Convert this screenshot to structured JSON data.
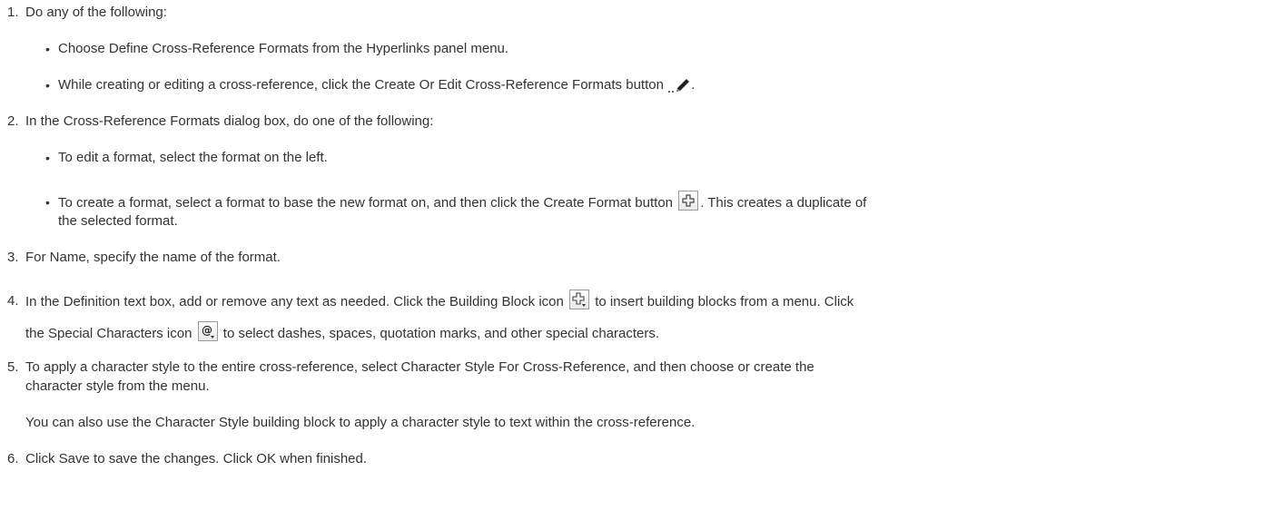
{
  "steps": [
    {
      "number": "1.",
      "text": "Do any of the following:"
    },
    {
      "number": "2.",
      "text": "In the Cross-Reference Formats dialog box, do one of the following:"
    },
    {
      "number": "3.",
      "text": "For Name, specify the name of the format."
    },
    {
      "number": "4.",
      "text_a": "In the Definition text box, add or remove any text as needed. Click the Building Block icon",
      "text_b": "to insert building blocks from a menu. Click",
      "text_c": "the Special Characters icon",
      "text_d": "to select dashes, spaces, quotation marks, and other special characters."
    },
    {
      "number": "5.",
      "text_a": "To apply a character style to the entire cross-reference, select Character Style For Cross-Reference, and then choose or create the",
      "text_b": "character style from the menu.",
      "note": "You can also use the Character Style building block to apply a character style to text within the cross-reference."
    },
    {
      "number": "6.",
      "text": "Click Save to save the changes. Click OK when finished."
    }
  ],
  "step1_bullets": [
    {
      "text": "Choose Define Cross-Reference Formats from the Hyperlinks panel menu."
    },
    {
      "text_a": "While creating or editing a cross-reference, click the Create Or Edit Cross-Reference Formats button",
      "text_b": "."
    }
  ],
  "step2_bullets": [
    {
      "text": "To edit a format, select the format on the left."
    },
    {
      "text_a": "To create a format, select a format to base the new format on, and then click the Create Format button",
      "text_b": ". This creates a duplicate of",
      "text_c": "the selected format."
    }
  ],
  "icons": {
    "edit_formats": "pencil-icon",
    "create_format": "plus-icon",
    "building_block": "building-block-icon",
    "special_characters": "at-sign-icon"
  },
  "bullet_char": "•"
}
